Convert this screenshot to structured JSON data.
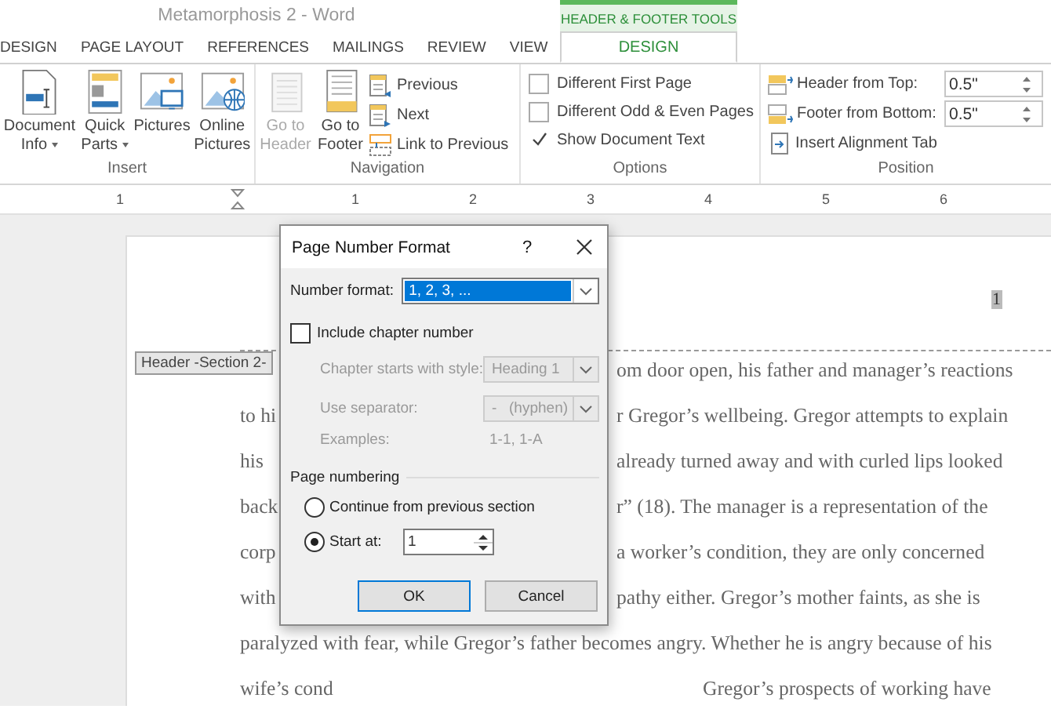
{
  "window": {
    "title": "Metamorphosis 2 - Word"
  },
  "tabs": [
    {
      "label": "DESIGN",
      "selected": false
    },
    {
      "label": "PAGE LAYOUT",
      "selected": false
    },
    {
      "label": "REFERENCES",
      "selected": false
    },
    {
      "label": "MAILINGS",
      "selected": false
    },
    {
      "label": "REVIEW",
      "selected": false
    },
    {
      "label": "VIEW",
      "selected": false
    }
  ],
  "contextual_tabs": {
    "title": "HEADER & FOOTER TOOLS",
    "tabs": [
      {
        "label": "DESIGN",
        "selected": true
      }
    ]
  },
  "ribbon": {
    "groups": [
      {
        "label": "Insert",
        "large_buttons": [
          {
            "label": "Document Info",
            "dropdown": true,
            "disabled": false
          },
          {
            "label": "Quick Parts",
            "dropdown": true,
            "disabled": false
          },
          {
            "label": "Pictures",
            "dropdown": false,
            "disabled": false
          },
          {
            "label": "Online Pictures",
            "dropdown": false,
            "disabled": false
          }
        ]
      },
      {
        "label": "Navigation",
        "large_buttons": [
          {
            "label": "Go to Header",
            "dropdown": false,
            "disabled": true
          },
          {
            "label": "Go to Footer",
            "dropdown": false,
            "disabled": false
          }
        ],
        "small_buttons": [
          {
            "label": "Previous"
          },
          {
            "label": "Next"
          },
          {
            "label": "Link to Previous"
          }
        ]
      },
      {
        "label": "Options",
        "checkboxes": [
          {
            "label": "Different First Page",
            "checked": false
          },
          {
            "label": "Different Odd & Even Pages",
            "checked": false
          },
          {
            "label": "Show Document Text",
            "checked": true
          }
        ]
      },
      {
        "label": "Position",
        "fields": [
          {
            "label": "Header from Top:",
            "value": "0.5\""
          },
          {
            "label": "Footer from Bottom:",
            "value": "0.5\""
          }
        ],
        "small_buttons": [
          {
            "label": "Insert Alignment Tab"
          }
        ]
      }
    ]
  },
  "ruler": {
    "numbers": [
      "1",
      "1",
      "2",
      "3",
      "4",
      "5",
      "6"
    ]
  },
  "document": {
    "header_tag": "Header -Section 2-",
    "page_number": "1",
    "lines": [
      {
        "kind": "split",
        "right": "om door open, his father and manager’s reactions"
      },
      {
        "kind": "split",
        "left": "to hi",
        "right": "r Gregor’s wellbeing. Gregor attempts to explain"
      },
      {
        "kind": "split",
        "left": "his",
        "right": "already turned away and with curled lips looked"
      },
      {
        "kind": "split",
        "left": "back",
        "right": "r” (18). The manager is a representation of the"
      },
      {
        "kind": "split",
        "left": "corp",
        "right": "a worker’s condition, they are only concerned"
      },
      {
        "kind": "split",
        "left": "with",
        "right": "pathy either. Gregor’s mother faints, as she is"
      },
      {
        "kind": "full",
        "left": "paralyzed with fear, while Gregor’s father becomes angry. Whether he is angry because of his"
      },
      {
        "kind": "gap",
        "left": "wife’s cond",
        "right": "Gregor’s prospects of working have"
      }
    ]
  },
  "dialog": {
    "title": "Page Number Format",
    "help": "?",
    "number_format": {
      "label": "Number format:",
      "value": "1, 2, 3, ..."
    },
    "include_chapter": {
      "label": "Include chapter number",
      "checked": false
    },
    "chapter_fields": [
      {
        "label": "Chapter starts with style:",
        "value": "Heading 1",
        "disabled": true
      },
      {
        "label": "Use separator:",
        "value": "-   (hyphen)",
        "disabled": true
      }
    ],
    "examples": {
      "label": "Examples:",
      "value": "1-1, 1-A",
      "disabled": true
    },
    "page_numbering": {
      "title": "Page numbering",
      "options": [
        {
          "label": "Continue from previous section",
          "selected": false
        },
        {
          "label": "Start at:",
          "selected": true,
          "value": "1"
        }
      ]
    },
    "buttons": [
      {
        "label": "OK",
        "default": true
      },
      {
        "label": "Cancel",
        "default": false
      }
    ]
  }
}
